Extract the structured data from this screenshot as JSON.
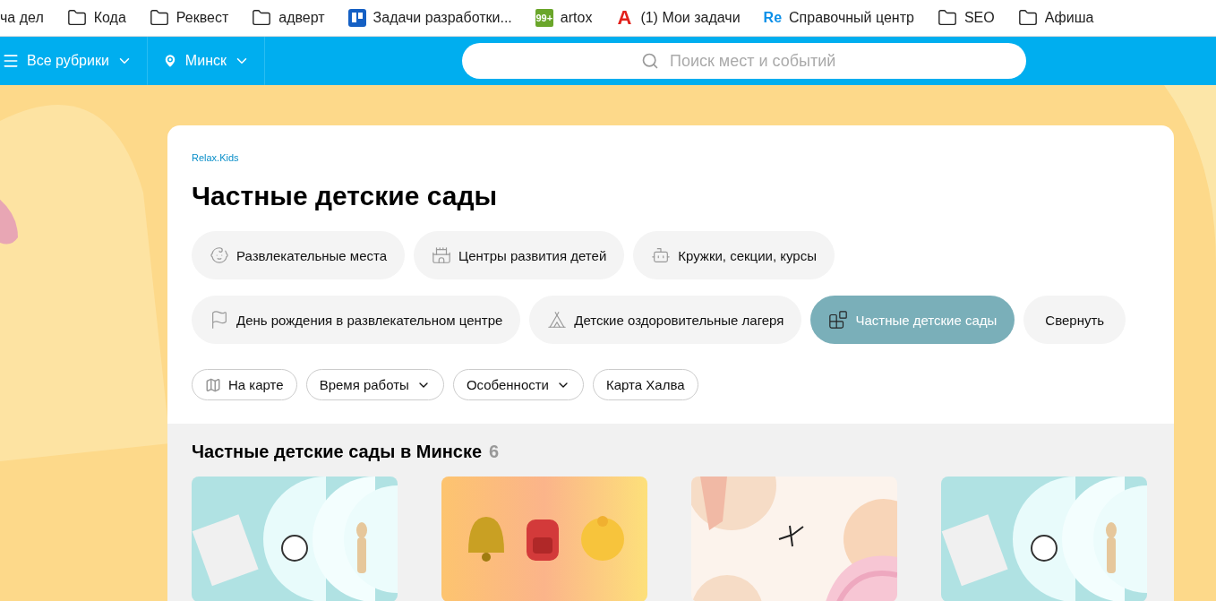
{
  "bookmarks": [
    {
      "kind": "text",
      "label": "ча дел"
    },
    {
      "kind": "folder",
      "label": "Кода"
    },
    {
      "kind": "folder",
      "label": "Реквест"
    },
    {
      "kind": "folder",
      "label": "адверт"
    },
    {
      "kind": "board",
      "label": "Задачи разработки..."
    },
    {
      "kind": "badge",
      "mark": "99+",
      "label": "artox"
    },
    {
      "kind": "letter",
      "mark": "A",
      "label": "(1) Мои задачи"
    },
    {
      "kind": "brand",
      "mark": "Re",
      "label": "Справочный центр"
    },
    {
      "kind": "folder",
      "label": "SEO"
    },
    {
      "kind": "folder",
      "label": "Афиша"
    }
  ],
  "header": {
    "rubrics": "Все рубрики",
    "city": "Минск",
    "search": {
      "placeholder": "Поиск мест и событий"
    }
  },
  "breadcrumb": "Relax.Kids",
  "title": "Частные детские сады",
  "categories": [
    {
      "kind": "chip",
      "label": "Развлекательные места",
      "selected": false
    },
    {
      "kind": "chip",
      "label": "Центры развития детей",
      "selected": false
    },
    {
      "kind": "chip",
      "label": "Кружки, секции, курсы",
      "selected": false
    },
    {
      "kind": "chip",
      "label": "День рождения в развлекательном центре",
      "selected": false
    },
    {
      "kind": "chip",
      "label": "Детские оздоровительные лагеря",
      "selected": false
    },
    {
      "kind": "chip",
      "label": "Частные детские сады",
      "selected": true
    },
    {
      "kind": "collapse",
      "label": "Свернуть",
      "selected": false
    }
  ],
  "filters": [
    {
      "kind": "map",
      "label": "На карте"
    },
    {
      "kind": "dropdown",
      "label": "Время работы"
    },
    {
      "kind": "dropdown",
      "label": "Особенности"
    },
    {
      "kind": "plain",
      "label": "Карта Халва"
    }
  ],
  "listing": {
    "heading": "Частные детские сады в Минске",
    "count": "6",
    "cards": [
      {
        "kind": "art"
      },
      {
        "kind": "school"
      },
      {
        "kind": "ballet"
      },
      {
        "kind": "art"
      }
    ]
  }
}
